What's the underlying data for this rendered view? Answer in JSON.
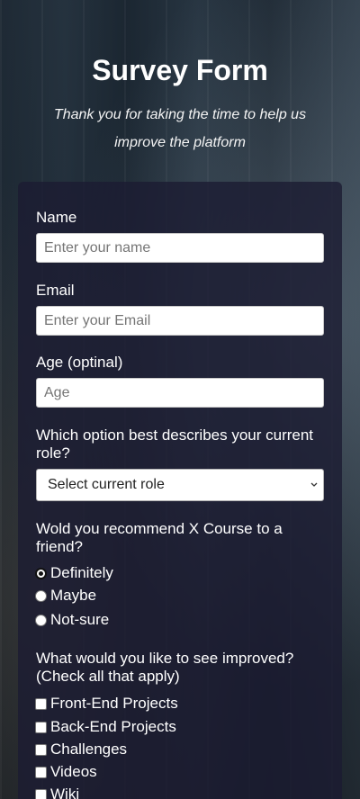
{
  "header": {
    "title": "Survey Form",
    "description": "Thank you for taking the time to help us improve the platform"
  },
  "form": {
    "name": {
      "label": "Name",
      "placeholder": "Enter your name"
    },
    "email": {
      "label": "Email",
      "placeholder": "Enter your Email"
    },
    "age": {
      "label": "Age (optinal)",
      "placeholder": "Age"
    },
    "role": {
      "label": "Which option best describes your current role?",
      "selected": "Select current role"
    },
    "recommend": {
      "label": "Wold you recommend X Course to a friend?",
      "options": [
        "Definitely",
        "Maybe",
        "Not-sure"
      ],
      "selected": "Definitely"
    },
    "improve": {
      "label": "What would you like to see improved? (Check all that apply)",
      "options": [
        "Front-End Projects",
        "Back-End Projects",
        "Challenges",
        "Videos",
        "Wiki"
      ]
    }
  }
}
